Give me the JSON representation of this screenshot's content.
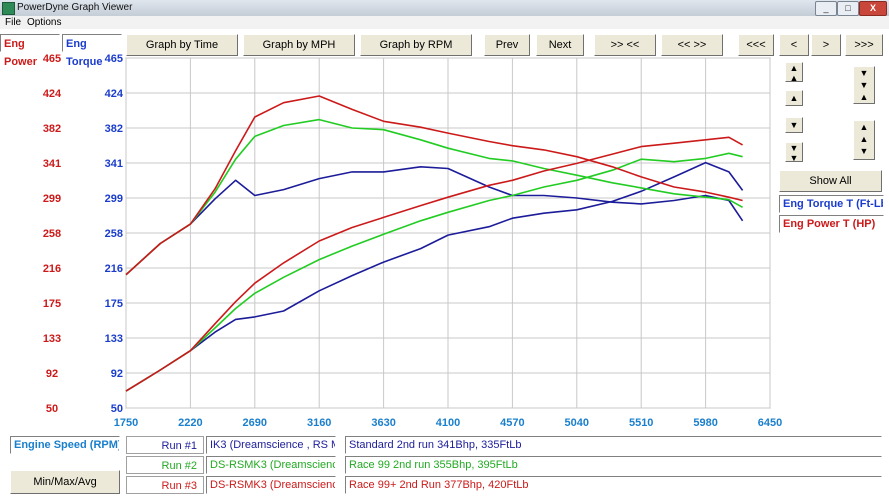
{
  "window": {
    "title": "PowerDyne Graph Viewer",
    "controls": [
      "_",
      "□",
      "X"
    ]
  },
  "menu": [
    "File",
    "Options"
  ],
  "toolbar": {
    "graph_by_time": "Graph by Time",
    "graph_by_mph": "Graph by MPH",
    "graph_by_rpm": "Graph by RPM",
    "prev": "Prev",
    "next": "Next",
    "zoom_in": ">> <<",
    "zoom_out": "<< >>",
    "scroll_far_left": "<<<",
    "scroll_left": "<",
    "scroll_right": ">",
    "scroll_far_right": ">>>"
  },
  "axes": {
    "power_header": "Eng Power",
    "torque_header": "Eng Torque",
    "power_ticks": [
      "465",
      "424",
      "382",
      "341",
      "299",
      "258",
      "216",
      "175",
      "133",
      "92",
      "50"
    ],
    "torque_ticks": [
      "465",
      "424",
      "382",
      "341",
      "299",
      "258",
      "216",
      "175",
      "133",
      "92",
      "50"
    ],
    "x_ticks": [
      "1750",
      "2220",
      "2690",
      "3160",
      "3630",
      "4100",
      "4570",
      "5040",
      "5510",
      "5980",
      "6450"
    ],
    "x_label": "Engine Speed (RPM)"
  },
  "side": {
    "show_all": "Show All",
    "legend_torque": "Eng Torque T (Ft-Lb",
    "legend_power": "Eng Power T (HP)"
  },
  "runs": [
    {
      "label": "Run #1",
      "name": "IK3 (Dreamscience , RS M",
      "desc": "Standard 2nd run 341Bhp, 335FtLb",
      "color": "#1c1c9a"
    },
    {
      "label": "Run #2",
      "name": "DS-RSMK3 (Dreamscience",
      "desc": "Race 99 2nd run 355Bhp, 395FtLb",
      "color": "#22cc22"
    },
    {
      "label": "Run #3",
      "name": "DS-RSMK3 (Dreamscience",
      "desc": "Race 99+ 2nd Run 377Bhp, 420FtLb",
      "color": "#cc1a1a"
    }
  ],
  "min_max_avg": "Min/Max/Avg",
  "colors": {
    "power_axis": "#cc1a1a",
    "torque_axis": "#1a3ccc",
    "x_axis": "#1a7fcc"
  },
  "chart_data": {
    "type": "line",
    "xlabel": "Engine Speed (RPM)",
    "xlim": [
      1750,
      6450
    ],
    "ylim": [
      50,
      465
    ],
    "grid": true,
    "series": [
      {
        "name": "IK3 (Dreamscience , RS M) torque",
        "color": "#1c1c9a",
        "x": [
          1750,
          2000,
          2220,
          2400,
          2550,
          2690,
          2900,
          3160,
          3400,
          3630,
          3900,
          4100,
          4400,
          4570,
          4800,
          5040,
          5300,
          5510,
          5750,
          5980,
          6150,
          6250
        ],
        "y": [
          208,
          245,
          268,
          298,
          320,
          302,
          309,
          322,
          330,
          330,
          336,
          334,
          312,
          302,
          302,
          299,
          294,
          292,
          296,
          302,
          296,
          272
        ]
      },
      {
        "name": "IK3 (Dreamscience , RS M) power",
        "color": "#1c1c9a",
        "x": [
          1750,
          2000,
          2220,
          2400,
          2550,
          2690,
          2900,
          3160,
          3400,
          3630,
          3900,
          4100,
          4400,
          4570,
          4800,
          5040,
          5300,
          5510,
          5750,
          5980,
          6150,
          6250
        ],
        "y": [
          70,
          95,
          118,
          140,
          155,
          158,
          165,
          189,
          207,
          223,
          239,
          255,
          265,
          275,
          281,
          285,
          295,
          307,
          324,
          341,
          330,
          308
        ]
      },
      {
        "name": "DS-RSMK3 Race 99 torque",
        "color": "#22cc22",
        "x": [
          1750,
          2000,
          2220,
          2400,
          2550,
          2690,
          2900,
          3160,
          3400,
          3630,
          3900,
          4100,
          4400,
          4570,
          4800,
          5040,
          5300,
          5510,
          5750,
          5980,
          6150,
          6250
        ],
        "y": [
          208,
          245,
          268,
          306,
          345,
          372,
          385,
          392,
          382,
          380,
          368,
          358,
          346,
          343,
          334,
          326,
          317,
          311,
          304,
          300,
          297,
          288
        ]
      },
      {
        "name": "DS-RSMK3 Race 99 power",
        "color": "#22cc22",
        "x": [
          1750,
          2000,
          2220,
          2400,
          2550,
          2690,
          2900,
          3160,
          3400,
          3630,
          3900,
          4100,
          4400,
          4570,
          4800,
          5040,
          5300,
          5510,
          5750,
          5980,
          6150,
          6250
        ],
        "y": [
          70,
          95,
          118,
          145,
          168,
          186,
          205,
          226,
          242,
          256,
          272,
          282,
          296,
          302,
          312,
          320,
          332,
          345,
          342,
          346,
          352,
          348
        ]
      },
      {
        "name": "DS-RSMK3 Race 99+ torque",
        "color": "#cc1a1a",
        "x": [
          1750,
          2000,
          2220,
          2400,
          2550,
          2690,
          2900,
          3160,
          3400,
          3630,
          3900,
          4100,
          4400,
          4570,
          4800,
          5040,
          5300,
          5510,
          5750,
          5980,
          6150,
          6250
        ],
        "y": [
          208,
          245,
          268,
          310,
          355,
          395,
          412,
          420,
          404,
          390,
          383,
          376,
          366,
          361,
          356,
          348,
          336,
          324,
          312,
          306,
          300,
          296
        ]
      },
      {
        "name": "DS-RSMK3 Race 99+ power",
        "color": "#cc1a1a",
        "x": [
          1750,
          2000,
          2220,
          2400,
          2550,
          2690,
          2900,
          3160,
          3400,
          3630,
          3900,
          4100,
          4400,
          4570,
          4800,
          5040,
          5300,
          5510,
          5750,
          5980,
          6150,
          6250
        ],
        "y": [
          70,
          95,
          118,
          150,
          176,
          198,
          222,
          248,
          264,
          276,
          290,
          300,
          314,
          320,
          331,
          340,
          351,
          360,
          364,
          368,
          371,
          362
        ]
      }
    ]
  }
}
